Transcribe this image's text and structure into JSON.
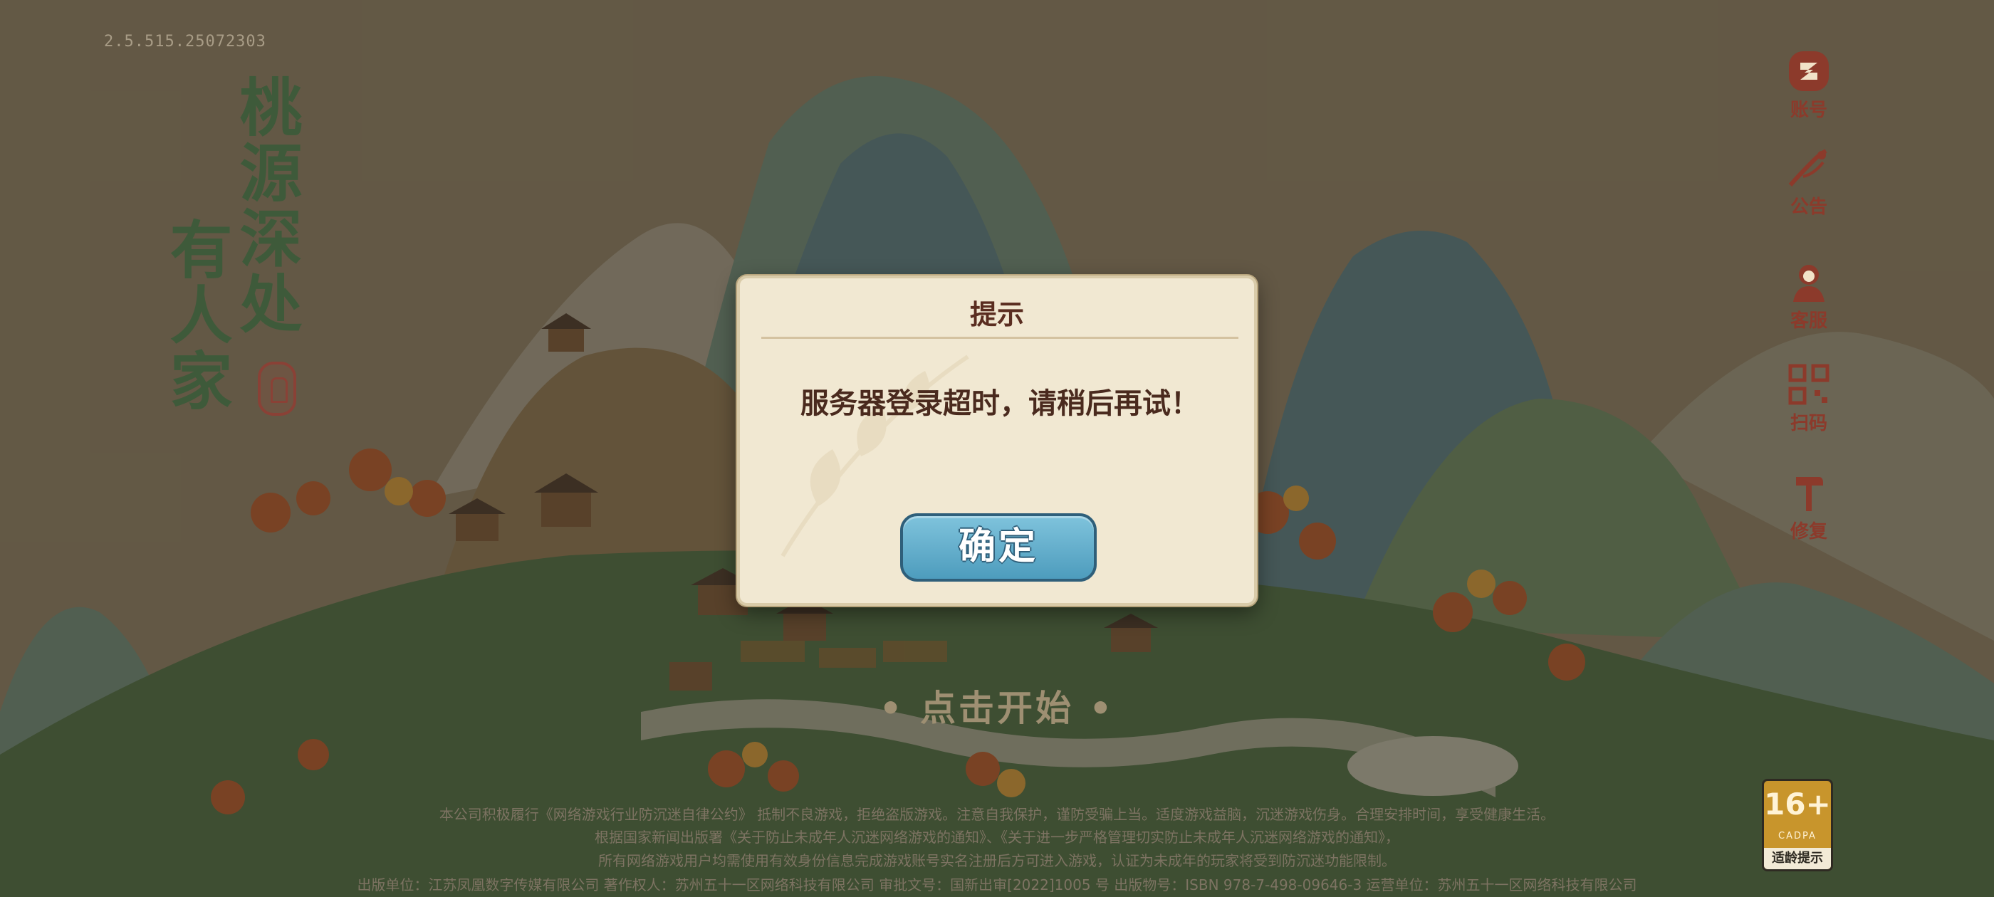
{
  "app": {
    "version": "2.5.515.25072303",
    "title_line_1": "桃源深处",
    "title_line_2": "有人家",
    "start_prompt": "• 点击开始 •"
  },
  "side_menu": {
    "items": [
      {
        "label": "账号",
        "icon": "account-icon"
      },
      {
        "label": "公告",
        "icon": "announcement-icon"
      },
      {
        "label": "客服",
        "icon": "customer-service-icon"
      },
      {
        "label": "扫码",
        "icon": "qr-scan-icon"
      },
      {
        "label": "修复",
        "icon": "repair-hammer-icon"
      }
    ]
  },
  "dialog": {
    "title": "提示",
    "message": "服务器登录超时，请稍后再试！",
    "confirm_label": "确定"
  },
  "legal": {
    "line_1": "本公司积极履行《网络游戏行业防沉迷自律公约》 抵制不良游戏，拒绝盗版游戏。注意自我保护，谨防受骗上当。适度游戏益脑，沉迷游戏伤身。合理安排时间，享受健康生活。",
    "line_2": "根据国家新闻出版署《关于防止未成年人沉迷网络游戏的通知》、《关于进一步严格管理切实防止未成年人沉迷网络游戏的通知》，",
    "line_3": "所有网络游戏用户均需使用有效身份信息完成游戏账号实名注册后方可进入游戏，认证为未成年的玩家将受到防沉迷功能限制。",
    "line_4": "出版单位：江苏凤凰数字传媒有限公司    著作权人：苏州五十一区网络科技有限公司    审批文号：国新出审[2022]1005 号    出版物号：ISBN 978-7-498-09646-3    运营单位：苏州五十一区网络科技有限公司"
  },
  "age_rating": {
    "rating": "16+",
    "org": "CADPA",
    "label": "适龄提示"
  },
  "colors": {
    "menu_label": "#8c3a2b",
    "title_green": "#3e5a3a",
    "dialog_bg": "#f1e8d2",
    "button_blue": "#5aa8c6"
  }
}
